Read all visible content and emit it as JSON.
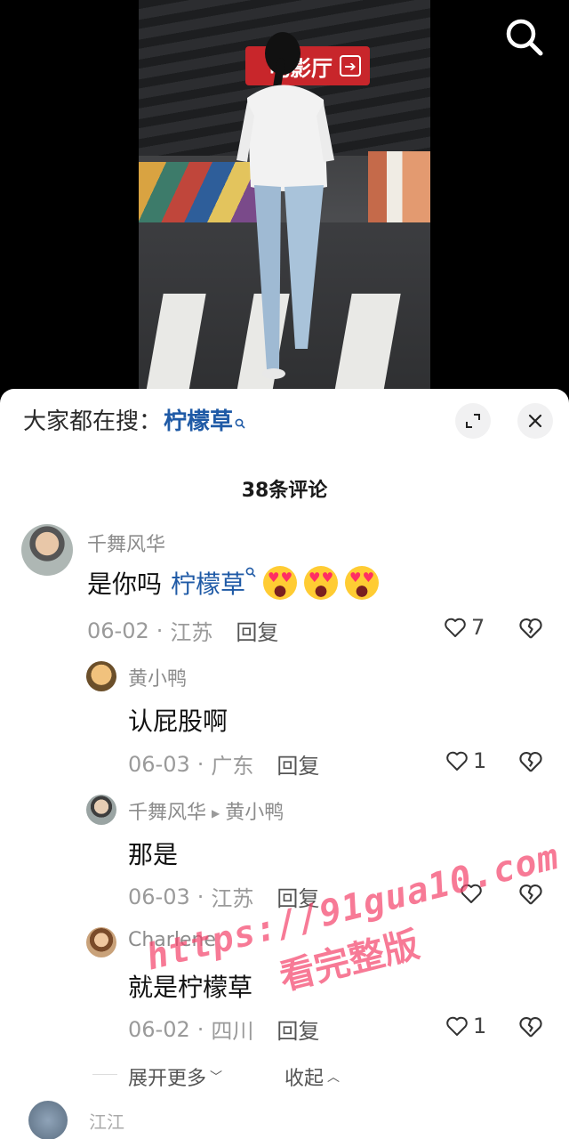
{
  "video": {
    "sign_text": "电影厅",
    "sign_arrow": "➔"
  },
  "top_bar": {
    "search_icon": "search-icon"
  },
  "sheet": {
    "search_prefix": "大家都在搜：",
    "search_keyword": "柠檬草",
    "expand_icon": "expand-icon",
    "close_icon": "close-icon",
    "comment_count": "38条评论"
  },
  "comments": [
    {
      "user": "千舞风华",
      "text": "是你吗",
      "keyword": "柠檬草",
      "emojis": [
        "heart-eyes-emoji",
        "heart-eyes-emoji",
        "heart-eyes-emoji"
      ],
      "date": "06-02",
      "location": "江苏",
      "reply_label": "回复",
      "likes": "7"
    }
  ],
  "replies": [
    {
      "user": "黄小鸭",
      "text": "认屁股啊",
      "date": "06-03",
      "location": "广东",
      "reply_label": "回复",
      "likes": "1"
    },
    {
      "user": "千舞风华",
      "reply_to": "黄小鸭",
      "text": "那是",
      "date": "06-03",
      "location": "江苏",
      "reply_label": "回复",
      "likes": ""
    },
    {
      "user": "Charlene",
      "text": "就是柠檬草",
      "date": "06-02",
      "location": "四川",
      "reply_label": "回复",
      "likes": "1"
    }
  ],
  "thread_actions": {
    "expand_more": "展开更多",
    "collapse": "收起"
  },
  "next_comment": {
    "user": "江江"
  },
  "watermark": {
    "url": "https://91gua10.com",
    "subtitle": "看完整版"
  },
  "colors": {
    "keyword_blue": "#1f5aa6",
    "watermark_pink": "#f4466e",
    "sign_red": "#c8262b"
  }
}
